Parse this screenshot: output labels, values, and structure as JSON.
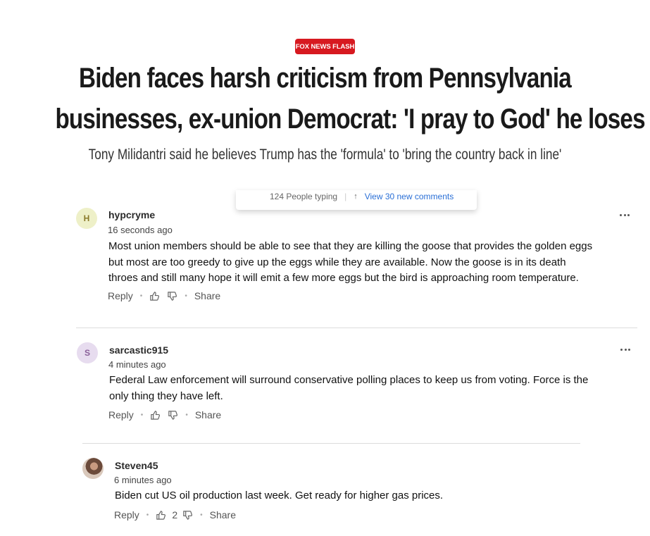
{
  "article": {
    "kicker": "FOX NEWS FLASH",
    "headline_line1": "Biden faces harsh criticism from Pennsylvania",
    "headline_line2": "businesses, ex-union Democrat: 'I pray to God' he loses",
    "subheadline": "Tony Milidantri said he believes Trump has the 'formula' to 'bring the country back in line'"
  },
  "notification": {
    "typing": "124 People typing",
    "view_new": "View 30 new comments"
  },
  "comments": [
    {
      "avatar_letter": "H",
      "username": "hypcryme",
      "time": "16 seconds ago",
      "lines": [
        "Most union members should be able to see that they are killing the goose that provides the golden eggs",
        "but most are too greedy to give up the eggs while they are available.  Now the goose is in its death",
        "throes and still many hope it will emit a few more eggs but the bird is approaching room temperature."
      ],
      "reply": "Reply",
      "share": "Share"
    },
    {
      "avatar_letter": "S",
      "username": "sarcastic915",
      "time": "4 minutes ago",
      "lines": [
        "Federal Law enforcement will surround conservative polling places to keep us from voting.  Force is the",
        "only thing they have left."
      ],
      "reply": "Reply",
      "share": "Share"
    },
    {
      "username": "Steven45",
      "time": "6 minutes ago",
      "lines": [
        "Biden cut US oil production last week. Get ready for higher gas prices."
      ],
      "reply": "Reply",
      "likes": "2",
      "share": "Share"
    }
  ],
  "colors": {
    "kicker_bg": "#d71920",
    "avatar_h": "#eef0c8",
    "avatar_s": "#e7dcef"
  }
}
